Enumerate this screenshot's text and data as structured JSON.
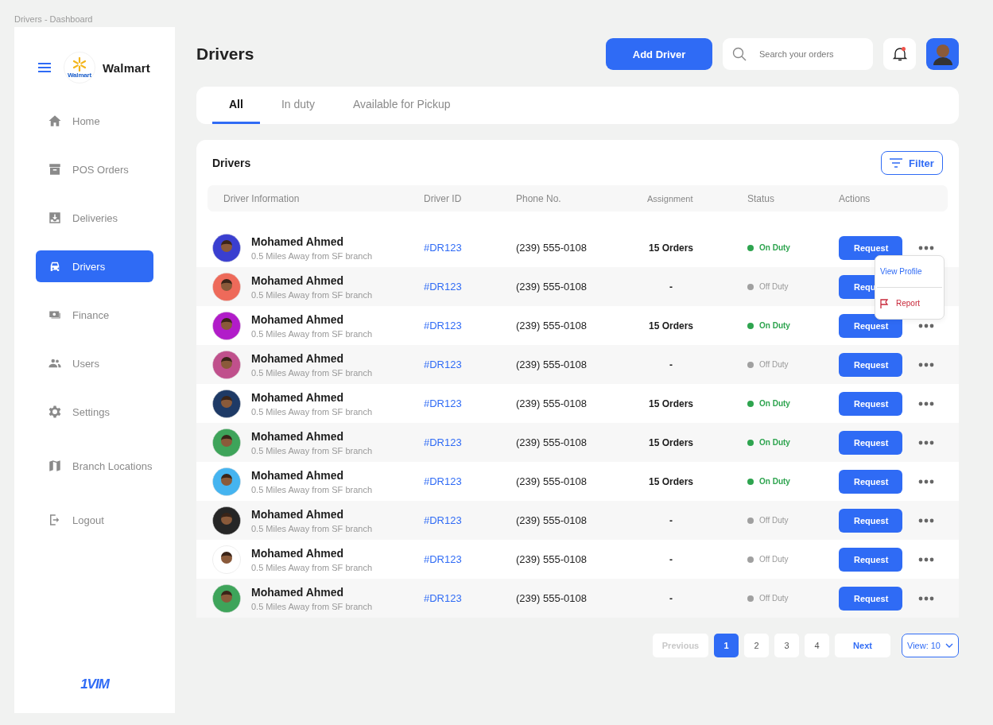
{
  "window": {
    "title": "Drivers - Dashboard"
  },
  "sidebar": {
    "brand": "Walmart",
    "logo_text": "Walmart",
    "items": [
      {
        "label": "Home",
        "selected": false
      },
      {
        "label": "POS Orders",
        "selected": false
      },
      {
        "label": "Deliveries",
        "selected": false
      },
      {
        "label": "Drivers",
        "selected": true
      },
      {
        "label": "Finance",
        "selected": false
      },
      {
        "label": "Users",
        "selected": false
      },
      {
        "label": "Settings",
        "selected": false
      },
      {
        "label": "Branch Locations",
        "selected": false
      },
      {
        "label": "Logout",
        "selected": false
      }
    ],
    "footer_logo": "1VIM"
  },
  "header": {
    "title": "Drivers",
    "add_button": "Add Driver",
    "search": {
      "placeholder": "Search your orders"
    },
    "notification_dot": true
  },
  "tabs": [
    {
      "label": "All",
      "selected": true
    },
    {
      "label": "In duty",
      "selected": false
    },
    {
      "label": "Available for Pickup",
      "selected": false
    }
  ],
  "table": {
    "title": "Drivers",
    "filter_button": "Filter",
    "columns": [
      "Driver Information",
      "Driver ID",
      "Phone No.",
      "Assignment",
      "Status",
      "Actions"
    ],
    "rows": [
      {
        "name": "Mohamed Ahmed",
        "distance": "0.5 Miles Away from SF branch",
        "id": "#DR123",
        "phone": "(239) 555-0108",
        "assignment": "15 Orders",
        "status": "On Duty",
        "on_duty": true,
        "action": "Request",
        "menu_open": true,
        "color": "#3a3fd0"
      },
      {
        "name": "Mohamed Ahmed",
        "distance": "0.5 Miles Away from SF branch",
        "id": "#DR123",
        "phone": "(239) 555-0108",
        "assignment": "-",
        "status": "Off Duty",
        "on_duty": false,
        "action": "Requ",
        "color": "#ee6a5a"
      },
      {
        "name": "Mohamed Ahmed",
        "distance": "0.5 Miles Away from SF branch",
        "id": "#DR123",
        "phone": "(239) 555-0108",
        "assignment": "15 Orders",
        "status": "On Duty",
        "on_duty": true,
        "action": "Request",
        "color": "#b11cc9"
      },
      {
        "name": "Mohamed Ahmed",
        "distance": "0.5 Miles Away from SF branch",
        "id": "#DR123",
        "phone": "(239) 555-0108",
        "assignment": "-",
        "status": "Off Duty",
        "on_duty": false,
        "action": "Request",
        "color": "#c0508c"
      },
      {
        "name": "Mohamed Ahmed",
        "distance": "0.5 Miles Away from SF branch",
        "id": "#DR123",
        "phone": "(239) 555-0108",
        "assignment": "15 Orders",
        "status": "On Duty",
        "on_duty": true,
        "action": "Request",
        "color": "#1e3a66"
      },
      {
        "name": "Mohamed Ahmed",
        "distance": "0.5 Miles Away from SF branch",
        "id": "#DR123",
        "phone": "(239) 555-0108",
        "assignment": "15 Orders",
        "status": "On Duty",
        "on_duty": true,
        "action": "Request",
        "color": "#3ea45a"
      },
      {
        "name": "Mohamed Ahmed",
        "distance": "0.5 Miles Away from SF branch",
        "id": "#DR123",
        "phone": "(239) 555-0108",
        "assignment": "15 Orders",
        "status": "On Duty",
        "on_duty": true,
        "action": "Request",
        "color": "#45b4f0"
      },
      {
        "name": "Mohamed Ahmed",
        "distance": "0.5 Miles Away from SF branch",
        "id": "#DR123",
        "phone": "(239) 555-0108",
        "assignment": "-",
        "status": "Off Duty",
        "on_duty": false,
        "action": "Request",
        "color": "#262626"
      },
      {
        "name": "Mohamed Ahmed",
        "distance": "0.5 Miles Away from SF branch",
        "id": "#DR123",
        "phone": "(239) 555-0108",
        "assignment": "-",
        "status": "Off Duty",
        "on_duty": false,
        "action": "Request",
        "color": "#ffffff"
      },
      {
        "name": "Mohamed Ahmed",
        "distance": "0.5 Miles Away from SF branch",
        "id": "#DR123",
        "phone": "(239) 555-0108",
        "assignment": "-",
        "status": "Off Duty",
        "on_duty": false,
        "action": "Request",
        "color": "#3ea45a"
      }
    ],
    "menu": {
      "items": [
        {
          "label": "View Profile",
          "kind": "plain"
        },
        {
          "label": "Report",
          "kind": "danger"
        }
      ]
    }
  },
  "pagination": {
    "previous": "Previous",
    "previous_disabled": true,
    "pages": [
      {
        "label": "1",
        "selected": true
      },
      {
        "label": "2",
        "selected": false
      },
      {
        "label": "3",
        "selected": false
      },
      {
        "label": "4",
        "selected": false
      }
    ],
    "next": "Next",
    "view": "View: 10"
  }
}
